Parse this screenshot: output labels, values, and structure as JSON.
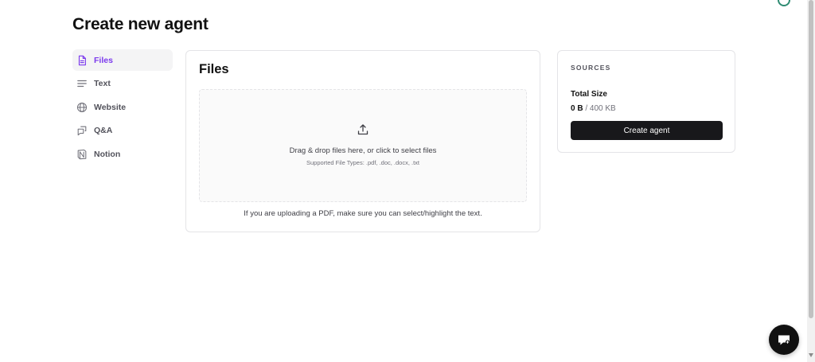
{
  "page": {
    "title": "Create new agent"
  },
  "sidebar": {
    "items": [
      {
        "label": "Files",
        "icon": "file-icon",
        "active": true
      },
      {
        "label": "Text",
        "icon": "text-lines-icon",
        "active": false
      },
      {
        "label": "Website",
        "icon": "globe-icon",
        "active": false
      },
      {
        "label": "Q&A",
        "icon": "chat-bubbles-icon",
        "active": false
      },
      {
        "label": "Notion",
        "icon": "notion-icon",
        "active": false
      }
    ]
  },
  "files": {
    "title": "Files",
    "dropzone": {
      "icon": "upload-icon",
      "main_text": "Drag & drop files here, or click to select files",
      "sub_text": "Supported File Types: .pdf, .doc, .docx, .txt"
    },
    "note": "If you are uploading a PDF, make sure you can select/highlight the text."
  },
  "sources": {
    "label": "SOURCES",
    "total_label": "Total Size",
    "used": "0 B",
    "separator": " / ",
    "limit": "400 KB",
    "button_label": "Create agent"
  },
  "chat_widget": {
    "icon": "chat-icon"
  },
  "colors": {
    "accent": "#7c3aed",
    "button_bg": "#18181b",
    "border": "#e4e4e7"
  }
}
